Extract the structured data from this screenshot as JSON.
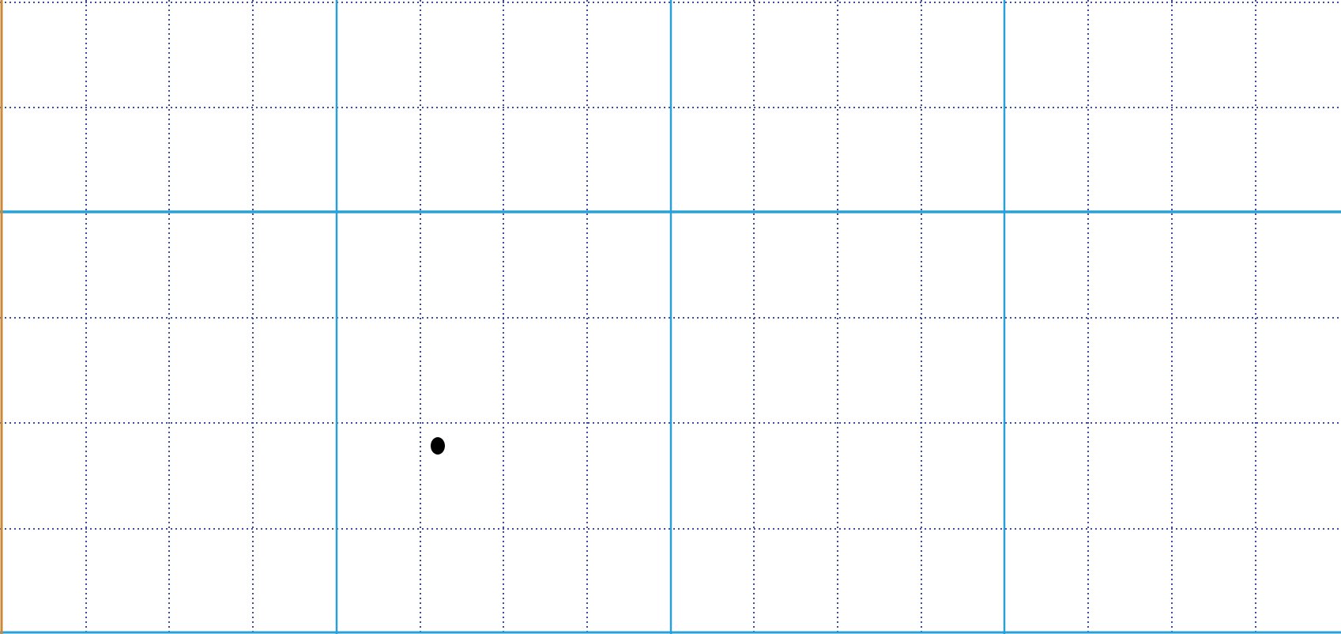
{
  "canvas": {
    "background": "#ffffff",
    "minor_grid_color": "#3d4d9c",
    "major_grid_color": "#2aa0d8",
    "left_edge_color": "#c8893a",
    "marker_color": "#000000"
  },
  "marker": {
    "icon": "dot"
  }
}
